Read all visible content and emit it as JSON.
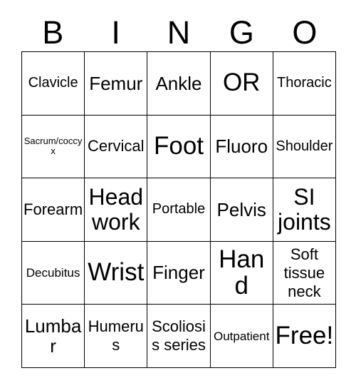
{
  "card": {
    "type": "bingo-card",
    "theme": "radiology-exams",
    "header_letters": [
      "B",
      "I",
      "N",
      "G",
      "O"
    ],
    "grid_size": {
      "columns": 5,
      "rows": 5
    },
    "colors": {
      "background": "#ffffff",
      "text": "#000000",
      "border": "#000000"
    },
    "rows": [
      [
        {
          "label": "Clavicle",
          "size": "md"
        },
        {
          "label": "Femur",
          "size": "xl"
        },
        {
          "label": "Ankle",
          "size": "xl"
        },
        {
          "label": "OR",
          "size": "max"
        },
        {
          "label": "Thoracic",
          "size": "md"
        }
      ],
      [
        {
          "label": "Sacrum/coccyx",
          "size": "xs"
        },
        {
          "label": "Cervical",
          "size": "lg"
        },
        {
          "label": "Foot",
          "size": "max"
        },
        {
          "label": "Fluoro",
          "size": "xl"
        },
        {
          "label": "Shoulder",
          "size": "md"
        }
      ],
      [
        {
          "label": "Forearm",
          "size": "lg"
        },
        {
          "label": "Head work",
          "size": "xxl"
        },
        {
          "label": "Portable",
          "size": "md"
        },
        {
          "label": "Pelvis",
          "size": "xl"
        },
        {
          "label": "SI joints",
          "size": "xxl"
        }
      ],
      [
        {
          "label": "Decubitus",
          "size": "sm"
        },
        {
          "label": "Wrist",
          "size": "max"
        },
        {
          "label": "Finger",
          "size": "xl"
        },
        {
          "label": "Hand",
          "size": "max"
        },
        {
          "label": "Soft tissue neck",
          "size": "lg"
        }
      ],
      [
        {
          "label": "Lumbar",
          "size": "xl"
        },
        {
          "label": "Humerus",
          "size": "lg"
        },
        {
          "label": "Scoliosis series",
          "size": "lg"
        },
        {
          "label": "Outpatient",
          "size": "sm"
        },
        {
          "label": "Free!",
          "size": "max"
        }
      ]
    ]
  }
}
